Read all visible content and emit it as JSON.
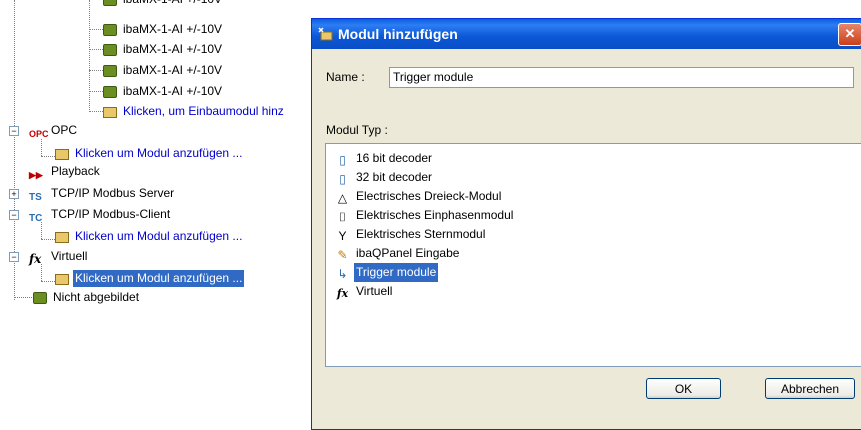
{
  "tree": {
    "items": [
      {
        "label": "ibaMX-1-AI +/-10V",
        "icon": "module-icon"
      },
      {
        "label": "ibaMX-1-AI +/-10V",
        "icon": "module-icon"
      },
      {
        "label": "ibaMX-1-AI +/-10V",
        "icon": "module-icon"
      },
      {
        "label": "ibaMX-1-AI +/-10V",
        "icon": "module-icon"
      },
      {
        "label": "Klicken, um Einbaumodul hinz",
        "icon": "add-module-icon"
      },
      {
        "label": "OPC",
        "icon": "opc-icon"
      },
      {
        "label": "Klicken um Modul anzufügen ...",
        "icon": "add-module-icon"
      },
      {
        "label": "Playback",
        "icon": "playback-icon"
      },
      {
        "label": "TCP/IP Modbus Server",
        "icon": "modbus-server-icon"
      },
      {
        "label": "TCP/IP Modbus-Client",
        "icon": "modbus-client-icon"
      },
      {
        "label": "Klicken um Modul anzufügen ...",
        "icon": "add-module-icon"
      },
      {
        "label": "Virtuell",
        "icon": "fx-icon"
      },
      {
        "label": "Klicken um Modul anzufügen ...",
        "icon": "add-module-icon"
      },
      {
        "label": "Nicht abgebildet",
        "icon": "module-icon"
      }
    ],
    "expanders": {
      "collapse": "−",
      "expand": "+"
    }
  },
  "dialog": {
    "title": "Modul hinzufügen",
    "close_glyph": "✕",
    "name_label": "Name :",
    "name_value": "Trigger module",
    "type_label": "Modul Typ :",
    "module_types": [
      {
        "label": "16 bit decoder",
        "icon": "decoder-icon",
        "glyph": "▯"
      },
      {
        "label": "32 bit decoder",
        "icon": "decoder-icon",
        "glyph": "▯"
      },
      {
        "label": "Electrisches Dreieck-Modul",
        "icon": "triangle-icon",
        "glyph": "△"
      },
      {
        "label": "Elektrisches Einphasenmodul",
        "icon": "single-phase-icon",
        "glyph": "⌷"
      },
      {
        "label": "Elektrisches Sternmodul",
        "icon": "star-icon",
        "glyph": "Y"
      },
      {
        "label": "ibaQPanel Eingabe",
        "icon": "pencil-icon",
        "glyph": "✎"
      },
      {
        "label": "Trigger module",
        "icon": "trigger-arrow-icon",
        "glyph": "↳"
      },
      {
        "label": "Virtuell",
        "icon": "fx-icon",
        "glyph": "fx"
      }
    ],
    "selected_type": "Trigger module",
    "ok_label": "OK",
    "cancel_label": "Abbrechen"
  },
  "colors": {
    "link": "#0000cc",
    "selection": "#316ac5",
    "titlebar": "#0a4ec5",
    "dialog_bg": "#ece9d8"
  }
}
